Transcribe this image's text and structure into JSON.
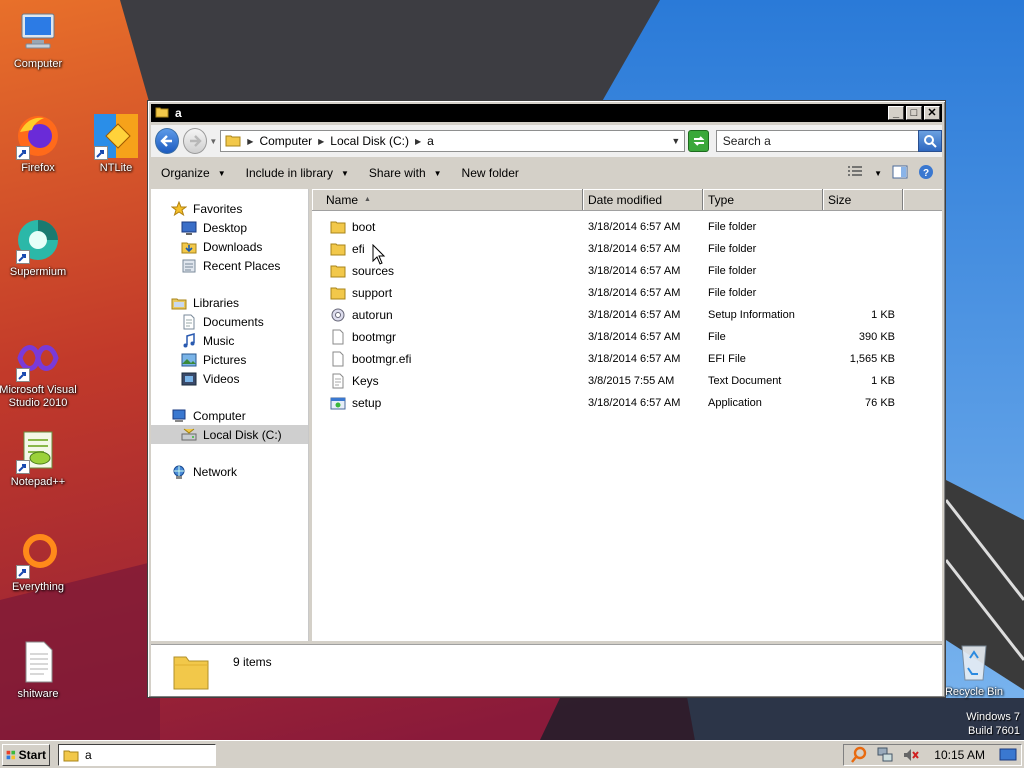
{
  "desktop": {
    "icons": [
      {
        "label": "Computer",
        "icon": "computer-icon"
      },
      {
        "label": "Firefox",
        "icon": "firefox-icon"
      },
      {
        "label": "NTLite",
        "icon": "ntlite-icon"
      },
      {
        "label": "Supermium",
        "icon": "supermium-icon"
      },
      {
        "label": "Microsoft Visual Studio 2010",
        "icon": "visual-studio-icon"
      },
      {
        "label": "Notepad++",
        "icon": "notepadpp-icon"
      },
      {
        "label": "Everything",
        "icon": "everything-icon"
      },
      {
        "label": "shitware",
        "icon": "text-file-icon"
      },
      {
        "label": "Recycle Bin",
        "icon": "recycle-bin-icon"
      }
    ],
    "watermark": {
      "line1": "Windows 7",
      "line2": "Build 7601"
    }
  },
  "window": {
    "title": "a",
    "controls": {
      "minimize": "_",
      "maximize": "□",
      "close": "✕"
    },
    "address": {
      "crumbs": [
        "Computer",
        "Local Disk (C:)",
        "a"
      ]
    },
    "search": {
      "placeholder": "Search a"
    },
    "commands": {
      "organize": "Organize",
      "include": "Include in library",
      "share": "Share with",
      "new_folder": "New folder"
    },
    "nav": {
      "favorites": {
        "label": "Favorites",
        "items": [
          "Desktop",
          "Downloads",
          "Recent Places"
        ]
      },
      "libraries": {
        "label": "Libraries",
        "items": [
          "Documents",
          "Music",
          "Pictures",
          "Videos"
        ]
      },
      "computer": {
        "label": "Computer",
        "items": [
          "Local Disk (C:)"
        ]
      },
      "network": {
        "label": "Network"
      }
    },
    "columns": {
      "name": "Name",
      "date": "Date modified",
      "type": "Type",
      "size": "Size"
    },
    "files": [
      {
        "name": "boot",
        "date": "3/18/2014 6:57 AM",
        "type": "File folder",
        "size": "",
        "icon": "folder-icon"
      },
      {
        "name": "efi",
        "date": "3/18/2014 6:57 AM",
        "type": "File folder",
        "size": "",
        "icon": "folder-icon"
      },
      {
        "name": "sources",
        "date": "3/18/2014 6:57 AM",
        "type": "File folder",
        "size": "",
        "icon": "folder-icon"
      },
      {
        "name": "support",
        "date": "3/18/2014 6:57 AM",
        "type": "File folder",
        "size": "",
        "icon": "folder-icon"
      },
      {
        "name": "autorun",
        "date": "3/18/2014 6:57 AM",
        "type": "Setup Information",
        "size": "1 KB",
        "icon": "setup-info-icon"
      },
      {
        "name": "bootmgr",
        "date": "3/18/2014 6:57 AM",
        "type": "File",
        "size": "390 KB",
        "icon": "file-icon"
      },
      {
        "name": "bootmgr.efi",
        "date": "3/18/2014 6:57 AM",
        "type": "EFI File",
        "size": "1,565 KB",
        "icon": "file-icon"
      },
      {
        "name": "Keys",
        "date": "3/8/2015 7:55 AM",
        "type": "Text Document",
        "size": "1 KB",
        "icon": "text-document-icon"
      },
      {
        "name": "setup",
        "date": "3/18/2014 6:57 AM",
        "type": "Application",
        "size": "76 KB",
        "icon": "application-icon"
      }
    ],
    "details": {
      "count": "9 items"
    }
  },
  "taskbar": {
    "start": "Start",
    "task": "a",
    "clock": "10:15 AM"
  }
}
